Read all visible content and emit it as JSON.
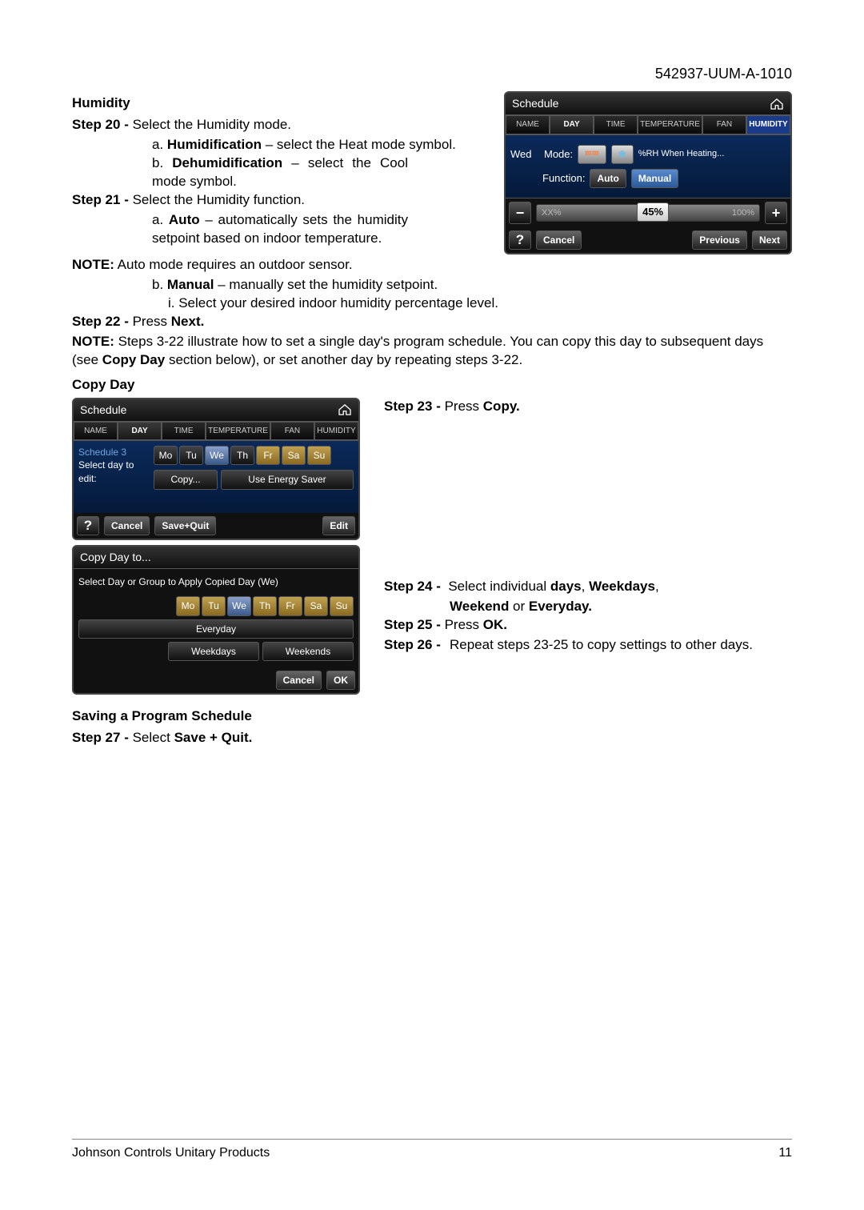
{
  "doc_id": "542937-UUM-A-1010",
  "sections": {
    "humidity": {
      "heading": "Humidity",
      "step20": "Step 20 -",
      "step20_text": "Select the Humidity mode.",
      "step20a_pre": "a.",
      "step20a_bold": "Humidification",
      "step20a_post": " – select the Heat mode symbol.",
      "step20b_pre": "b.",
      "step20b_bold": "Dehumidification",
      "step20b_post": " – select the Cool mode symbol.",
      "step21": "Step 21 -",
      "step21_text": "Select the Humidity function.",
      "step21a_pre": "a.",
      "step21a_bold": "Auto",
      "step21a_post": " – automatically sets the humidity setpoint based on indoor temperature.",
      "note1_pre": "NOTE:",
      "note1": " Auto mode requires an outdoor sensor.",
      "step21b_pre": "b.",
      "step21b_bold": "Manual",
      "step21b_post": " – manually set the humidity setpoint.",
      "step21bi": "i. Select your desired indoor humidity percentage level.",
      "step22": "Step 22 -",
      "step22_text_pre": "Press ",
      "step22_text_bold": "Next.",
      "note2_pre": "NOTE:",
      "note2a": " Steps 3-22 illustrate how to set a single day's program schedule.  You can copy this day to subsequent days (see ",
      "note2b": "Copy Day",
      "note2c": " section below), or set another day by repeating steps 3-22."
    },
    "copyday": {
      "heading": "Copy Day",
      "step23": "Step 23 -",
      "step23_text_pre": "Press ",
      "step23_text_bold": "Copy.",
      "step24": "Step 24 -",
      "step24a": "Select individual ",
      "step24b": "days",
      "step24c": ", ",
      "step24d": "Weekdays",
      "step24e": ", ",
      "step24f": "Weekend",
      "step24g": " or ",
      "step24h": "Everyday.",
      "step25": "Step 25 -",
      "step25_pre": "Press ",
      "step25_bold": "OK.",
      "step26": "Step 26 -",
      "step26_text": "Repeat steps 23-25 to copy settings to other days."
    },
    "saving": {
      "heading": "Saving a Program Schedule",
      "step27": "Step 27 -",
      "step27_pre": "Select ",
      "step27_bold": "Save + Quit."
    }
  },
  "device1": {
    "title": "Schedule",
    "tabs": [
      "NAME",
      "DAY",
      "TIME",
      "TEMPERATURE",
      "FAN",
      "HUMIDITY"
    ],
    "wed": "Wed",
    "mode_lbl": "Mode:",
    "func_lbl": "Function:",
    "auto": "Auto",
    "manual": "Manual",
    "rh_heating": "%RH When Heating...",
    "slider_min": "XX%",
    "slider_val": "45%",
    "slider_max": "100%",
    "cancel": "Cancel",
    "previous": "Previous",
    "next": "Next"
  },
  "device2": {
    "title": "Schedule",
    "tabs": [
      "NAME",
      "DAY",
      "TIME",
      "TEMPERATURE",
      "FAN",
      "HUMIDITY"
    ],
    "sched3": "Schedule 3",
    "selday": "Select day to edit:",
    "days": [
      "Mo",
      "Tu",
      "We",
      "Th",
      "Fr",
      "Sa",
      "Su"
    ],
    "copy": "Copy...",
    "use_saver": "Use Energy Saver",
    "cancel": "Cancel",
    "savequit": "Save+Quit",
    "edit": "Edit"
  },
  "device3": {
    "title": "Copy Day to...",
    "prompt": "Select Day or Group to Apply Copied Day (We)",
    "days": [
      "Mo",
      "Tu",
      "We",
      "Th",
      "Fr",
      "Sa",
      "Su"
    ],
    "everyday": "Everyday",
    "weekdays": "Weekdays",
    "weekends": "Weekends",
    "cancel": "Cancel",
    "ok": "OK"
  },
  "footer": {
    "left": "Johnson Controls Unitary Products",
    "right": "11"
  }
}
